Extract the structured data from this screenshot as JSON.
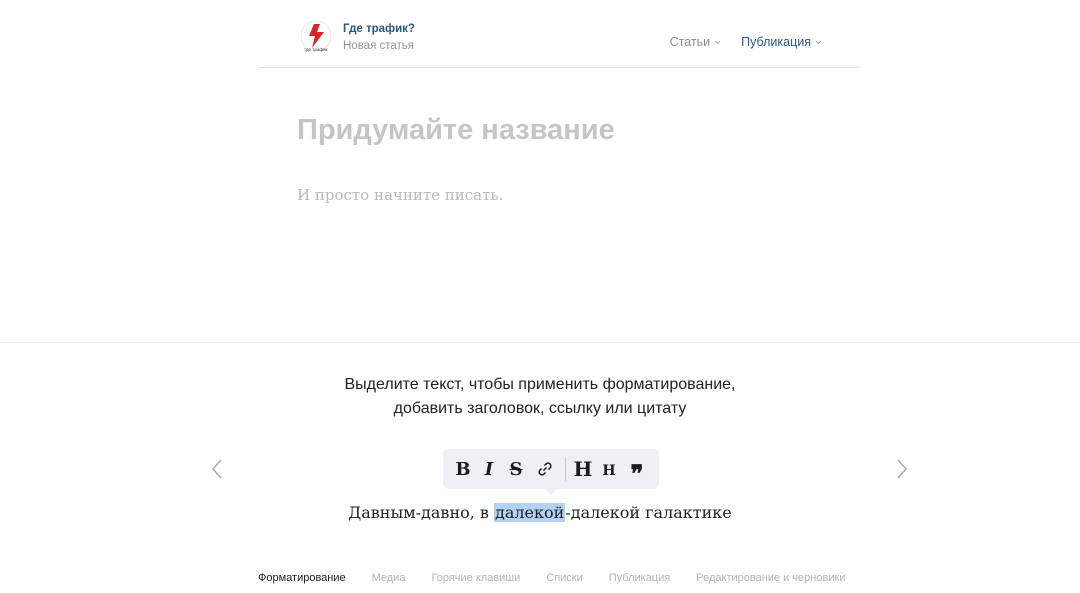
{
  "header": {
    "group_name": "Где трафик?",
    "doc_status": "Новая статья",
    "logo_caption": "где трафик",
    "nav": [
      {
        "label": "Статьи"
      },
      {
        "label": "Публикация"
      }
    ]
  },
  "editor": {
    "title_placeholder": "Придумайте название",
    "body_placeholder": "И просто начните писать."
  },
  "tips": {
    "line1": "Выделите текст, чтобы применить форматирование,",
    "line2": "добавить заголовок, ссылку или цитату",
    "toolbar": {
      "bold": "B",
      "italic": "I",
      "strike": "S",
      "heading1": "H",
      "heading2": "H",
      "quote": "❞"
    },
    "sample": {
      "before": "Давным-давно, в ",
      "highlight": "далекой",
      "after": "-далекой галактике"
    },
    "tabs": [
      {
        "label": "Форматирование",
        "active": true
      },
      {
        "label": "Медиа"
      },
      {
        "label": "Горячие клавиши"
      },
      {
        "label": "Списки"
      },
      {
        "label": "Публикация"
      },
      {
        "label": "Редактирование и черновики"
      }
    ]
  },
  "colors": {
    "accent": "#2a5885",
    "highlight": "#b4d1f3",
    "logo_red": "#d8232a"
  },
  "icons": [
    "logo",
    "chevron-down-icon",
    "link-icon",
    "chevron-left-icon",
    "chevron-right-icon"
  ]
}
